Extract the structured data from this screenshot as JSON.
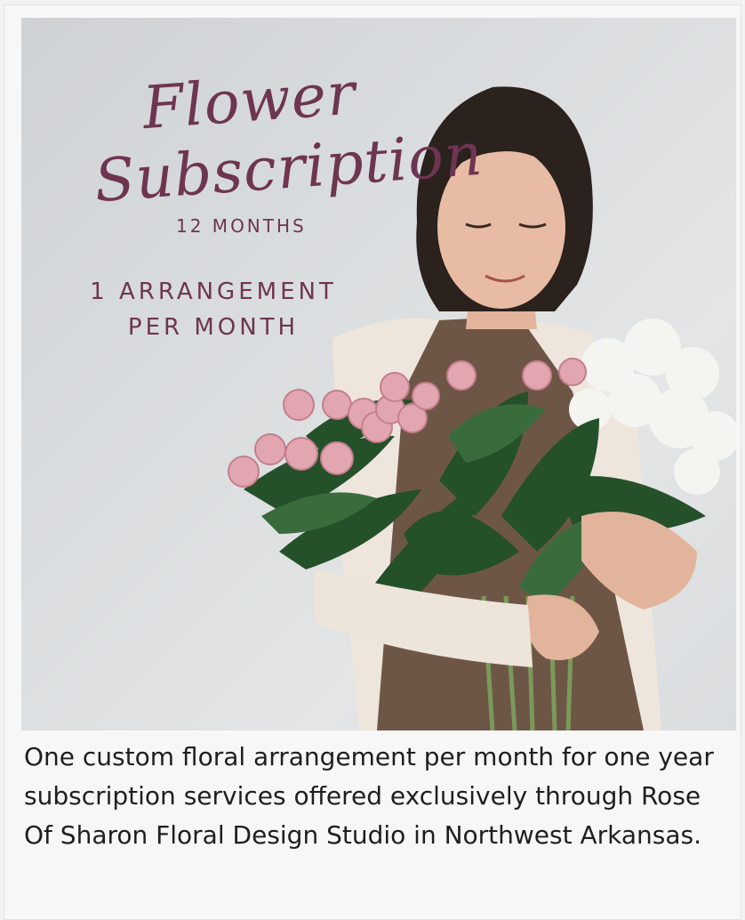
{
  "product": {
    "image": {
      "title_line1": "Flower",
      "title_line2": "Subscription",
      "duration": "12 MONTHS",
      "offer_line1": "1 ARRANGEMENT",
      "offer_line2": "PER MONTH"
    },
    "description": "One custom floral arrangement per month for one year subscription services offered exclusively through Rose Of Sharon Floral Design Studio in Northwest Arkansas."
  },
  "colors": {
    "script_accent": "#6e3551",
    "background": "#f7f7f7",
    "text": "#1f1f1f"
  }
}
